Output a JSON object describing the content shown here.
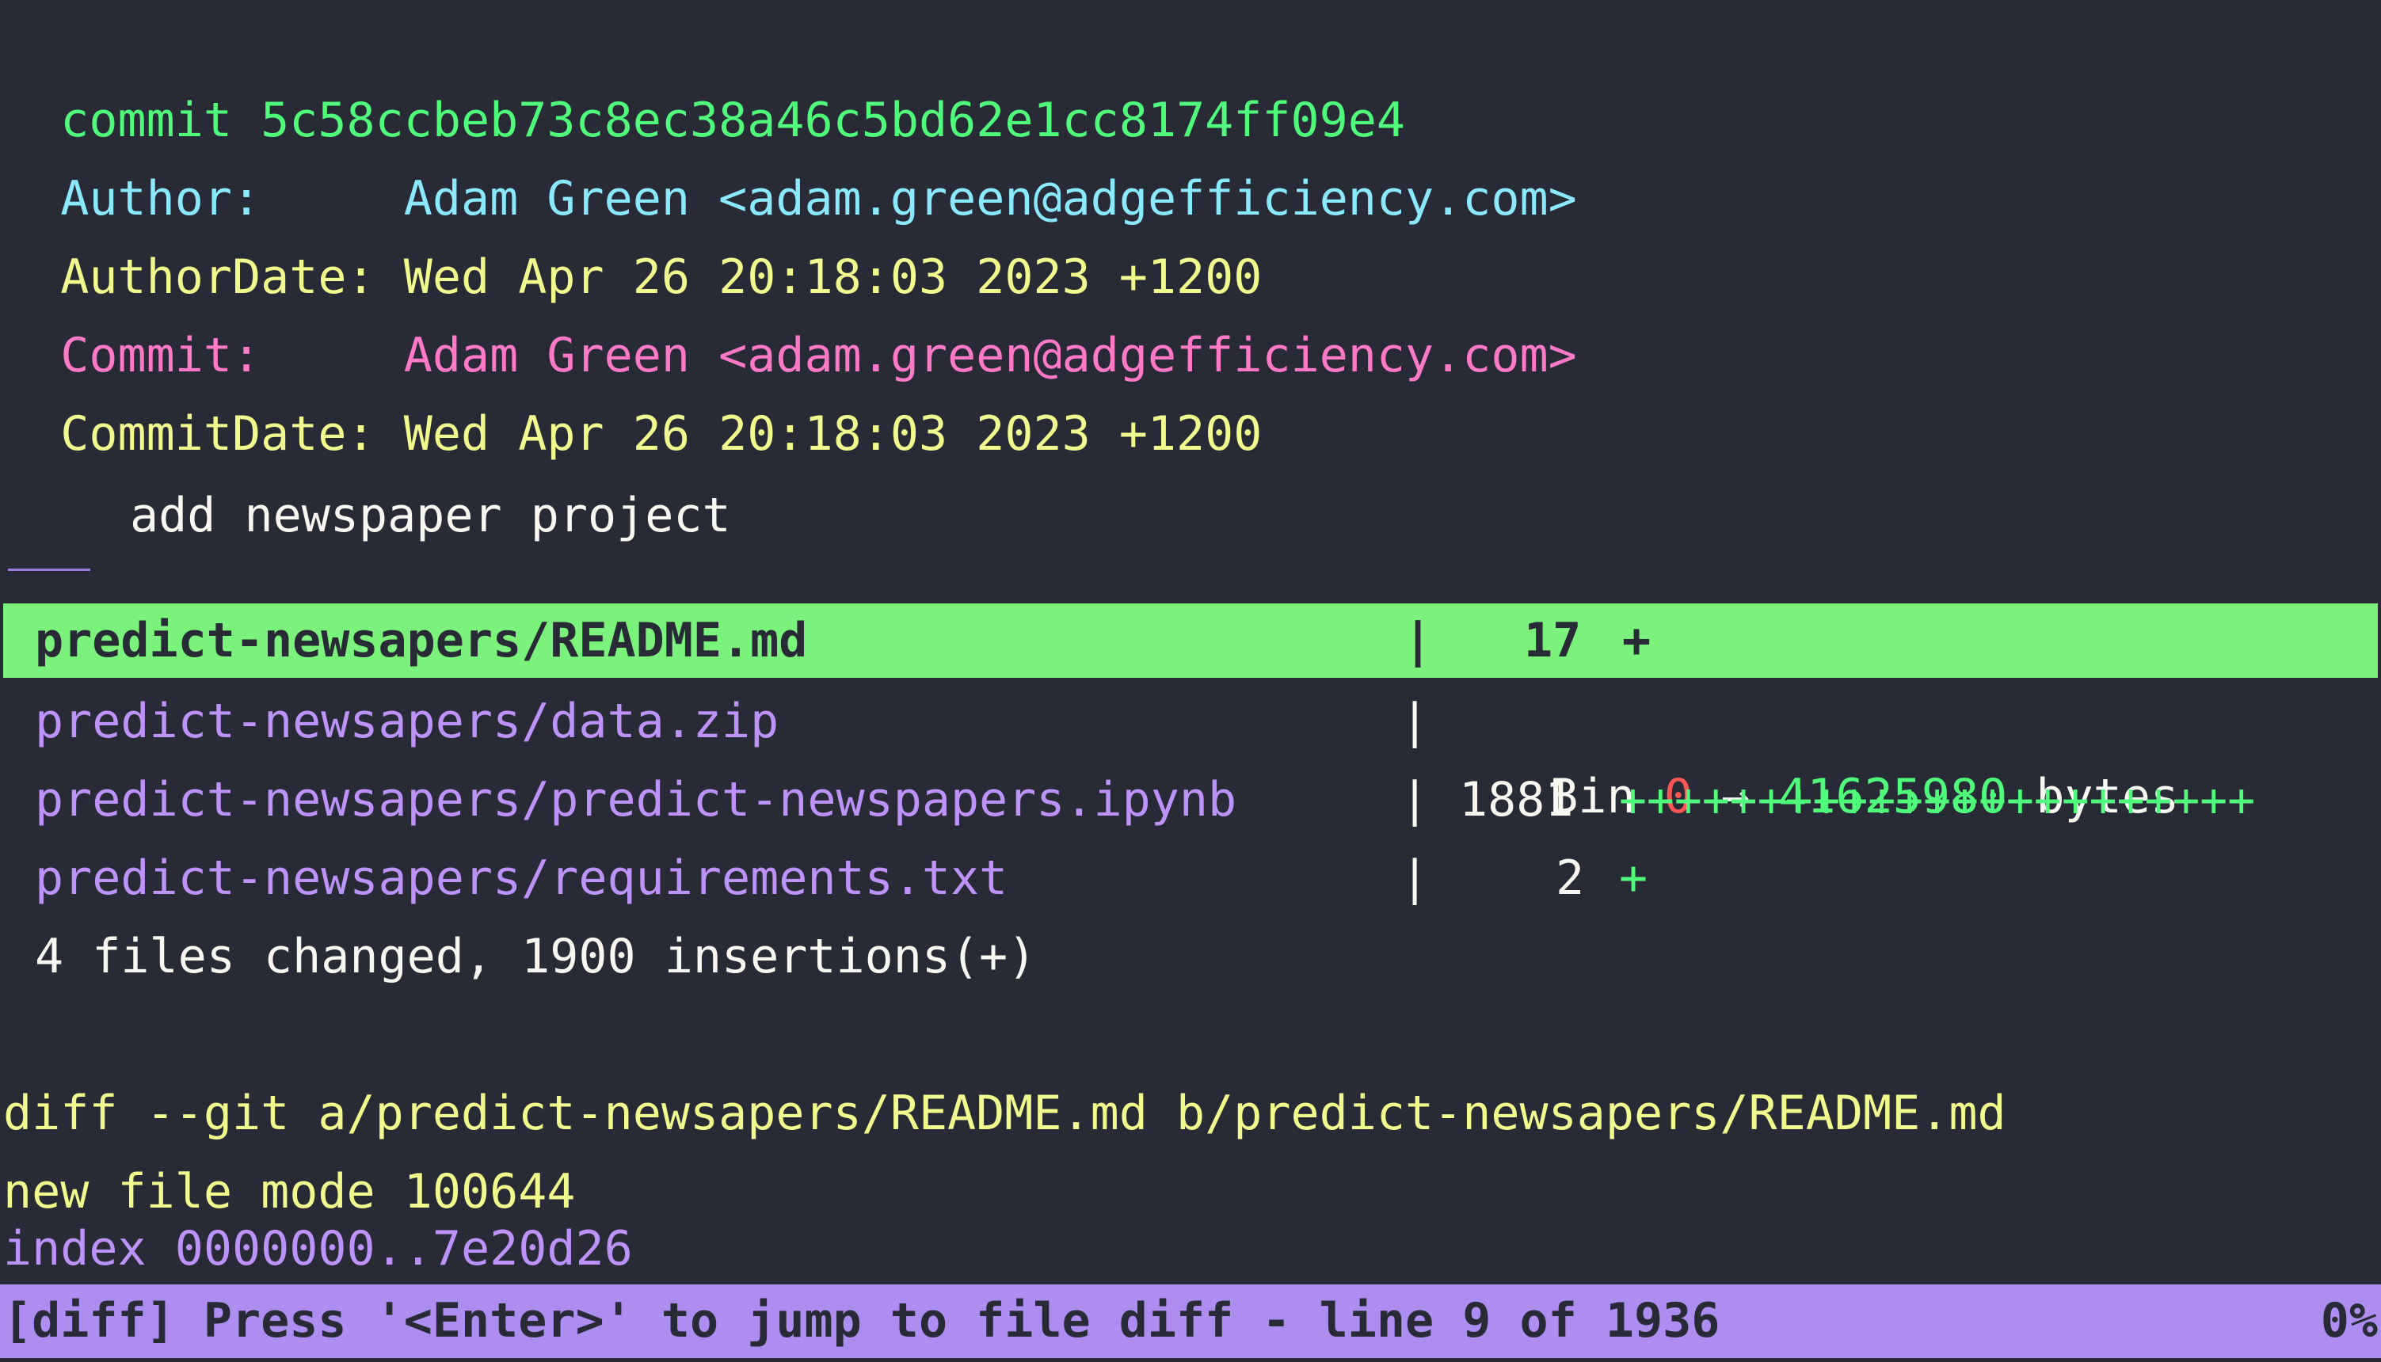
{
  "commit": {
    "label": "commit",
    "hash": "5c58ccbeb73c8ec38a46c5bd62e1cc8174ff09e4",
    "author_label": "Author:",
    "author": "Adam Green <adam.green@adgefficiency.com>",
    "author_date_label": "AuthorDate:",
    "author_date": "Wed Apr 26 20:18:03 2023 +1200",
    "committer_label": "Commit:",
    "committer": "Adam Green <adam.green@adgefficiency.com>",
    "commit_date_label": "CommitDate:",
    "commit_date": "Wed Apr 26 20:18:03 2023 +1200",
    "message": "add newspaper project"
  },
  "files": [
    {
      "path": "predict-newsapers/README.md",
      "count": "17",
      "graph": "+",
      "selected": true
    },
    {
      "path": "predict-newsapers/data.zip",
      "bin_label": "Bin",
      "bin_from": "0",
      "arrow": "→",
      "bin_to": "41625980",
      "bin_unit": "bytes"
    },
    {
      "path": "predict-newsapers/predict-newspapers.ipynb",
      "count": "1881",
      "graph": "+++++++++++++++++++++++"
    },
    {
      "path": "predict-newsapers/requirements.txt",
      "count": "2",
      "graph": "+"
    }
  ],
  "pipe": "|",
  "summary": "4 files changed, 1900 insertions(+)",
  "diff": {
    "header": "diff --git a/predict-newsapers/README.md b/predict-newsapers/README.md",
    "mode": "new file mode 100644",
    "index": "index 0000000..7e20d26"
  },
  "status_bar": {
    "text": "[diff] Press '<Enter>' to jump to file diff - line 9 of 1936",
    "percent": "0%"
  },
  "colors": {
    "background": "#282a36",
    "selection": "#7bf27b",
    "status_bar": "#ad8ef0"
  }
}
